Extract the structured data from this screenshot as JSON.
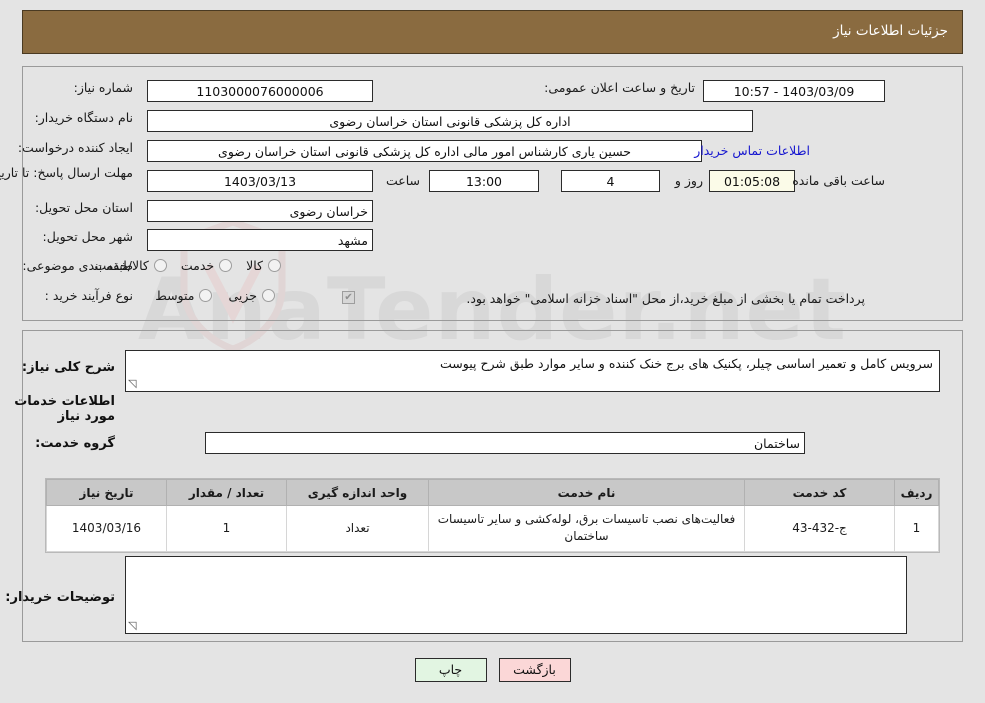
{
  "header": {
    "title": "جزئیات اطلاعات نیاز",
    "bg_color": "#8a6b40",
    "text_color": "#ffffff"
  },
  "watermark": {
    "text": "AnaTender.net"
  },
  "top_panel": {
    "need_number": {
      "label": "شماره نیاز:",
      "value": "1103000076000006"
    },
    "announce_datetime": {
      "label": "تاریخ و ساعت اعلان عمومی:",
      "value": "1403/03/09 - 10:57"
    },
    "buyer_org": {
      "label": "نام دستگاه خریدار:",
      "value": "اداره کل پزشکی قانونی استان خراسان رضوی"
    },
    "creator": {
      "label": "ایجاد کننده درخواست:",
      "value": "حسین یاری کارشناس امور مالی اداره کل پزشکی قانونی استان خراسان رضوی",
      "contact_link": "اطلاعات تماس خریدار"
    },
    "deadline": {
      "label": "مهلت ارسال پاسخ: تا تاریخ:",
      "date": "1403/03/13",
      "time_label": "ساعت",
      "time": "13:00",
      "days": "4",
      "days_label": "روز و",
      "countdown": "01:05:08",
      "countdown_suffix": "ساعت باقی مانده"
    },
    "delivery_province": {
      "label": "استان محل تحویل:",
      "value": "خراسان رضوی"
    },
    "delivery_city": {
      "label": "شهر محل تحویل:",
      "value": "مشهد"
    },
    "category": {
      "label": "طبقه بندی موضوعی:",
      "options": [
        "کالا",
        "خدمت",
        "کالا/خدمت"
      ],
      "selected": ""
    },
    "purchase_type": {
      "label": "نوع فرآیند خرید :",
      "options": [
        "جزیی",
        "متوسط"
      ],
      "selected": "",
      "treasury_note": "پرداخت تمام یا بخشی از مبلغ خرید،از محل \"اسناد خزانه اسلامی\" خواهد بود.",
      "treasury_checked": true
    }
  },
  "body_panel": {
    "general_desc": {
      "label": "شرح کلی نیاز:",
      "value": "سرویس کامل و تعمیر اساسی چیلر، پکنیک های برج خنک کننده و سایر موارد طبق شرح پیوست"
    },
    "services_section_title": "اطلاعات خدمات مورد نیاز",
    "service_group": {
      "label": "گروه خدمت:",
      "value": "ساختمان"
    },
    "table": {
      "columns": [
        "ردیف",
        "کد خدمت",
        "نام خدمت",
        "واحد اندازه گیری",
        "تعداد / مقدار",
        "تاریخ نیاز"
      ],
      "rows": [
        {
          "row_no": "1",
          "service_code": "ج-432-43",
          "service_name": "فعالیت‌های نصب تاسیسات برق، لوله‌کشی و سایر تاسیسات ساختمان",
          "unit": "تعداد",
          "quantity": "1",
          "need_date": "1403/03/16"
        }
      ]
    },
    "buyer_comments": {
      "label": "توضیحات خریدار:",
      "value": ""
    }
  },
  "footer": {
    "print_label": "چاپ",
    "back_label": "بازگشت"
  }
}
